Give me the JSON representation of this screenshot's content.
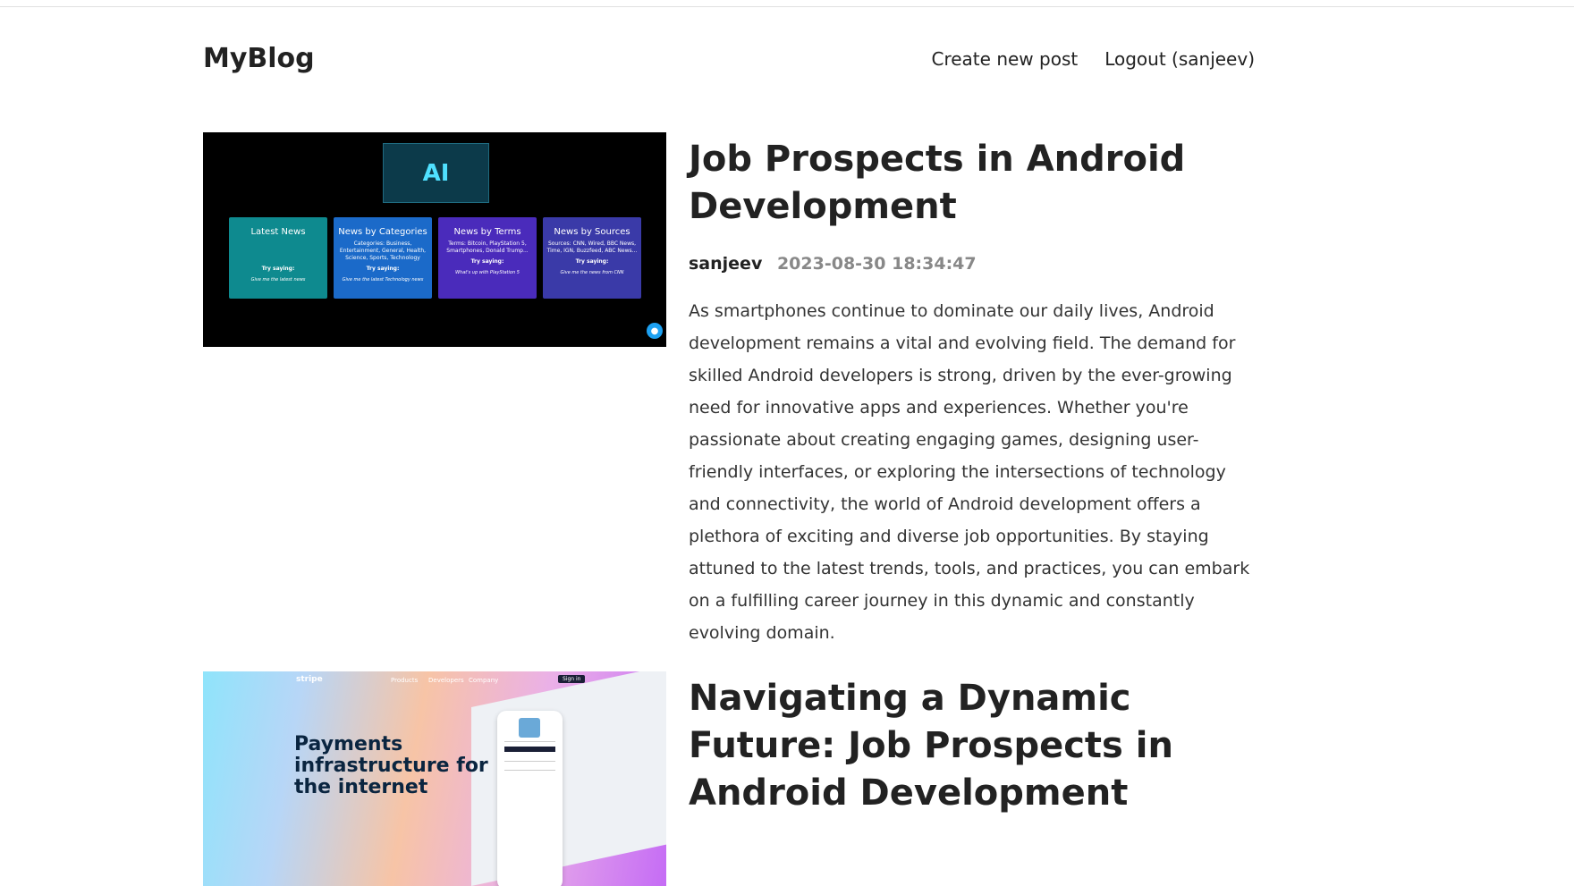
{
  "header": {
    "logo": "MyBlog",
    "nav": {
      "create_post": "Create new post",
      "logout": "Logout (sanjeev)"
    }
  },
  "posts": [
    {
      "title": "Job Prospects in Android Development",
      "author": "sanjeev",
      "date": "2023-08-30 18:34:47",
      "summary": "As smartphones continue to dominate our daily lives, Android development remains a vital and evolving field. The demand for skilled Android developers is strong, driven by the ever-growing need for innovative apps and experiences. Whether you're passionate about creating engaging games, designing user-friendly interfaces, or exploring the intersections of technology and connectivity, the world of Android development offers a plethora of exciting and diverse job opportunities. By staying attuned to the latest trends, tools, and practices, you can embark on a fulfilling career journey in this dynamic and constantly evolving domain.",
      "image": {
        "logo_text": "AI",
        "cards": [
          {
            "title": "Latest News",
            "details": "",
            "try": "Try saying:",
            "example": "Give me the latest news",
            "color": "#0e8a8f"
          },
          {
            "title": "News by Categories",
            "details": "Categories: Business, Entertainment, General, Health, Science, Sports, Technology",
            "try": "Try saying:",
            "example": "Give me the latest Technology news",
            "color": "#1b6ac9"
          },
          {
            "title": "News by Terms",
            "details": "Terms: Bitcoin, PlayStation 5, Smartphones, Donald Trump...",
            "try": "Try saying:",
            "example": "What's up with PlayStation 5",
            "color": "#4a2bbb"
          },
          {
            "title": "News by Sources",
            "details": "Sources: CNN, Wired, BBC News, Time, IGN, Buzzfeed, ABC News...",
            "try": "Try saying:",
            "example": "Give me the news from CNN",
            "color": "#3a3aa8"
          }
        ]
      }
    },
    {
      "title": "Navigating a Dynamic Future: Job Prospects in Android Development",
      "image": {
        "brand": "stripe",
        "nav": [
          "Products",
          "Developers",
          "Company"
        ],
        "signin": "Sign in",
        "headline": "Payments infrastructure for the internet"
      }
    }
  ],
  "colors": {
    "text": "#222222",
    "date": "#888888",
    "mic": "#1da1f2"
  }
}
